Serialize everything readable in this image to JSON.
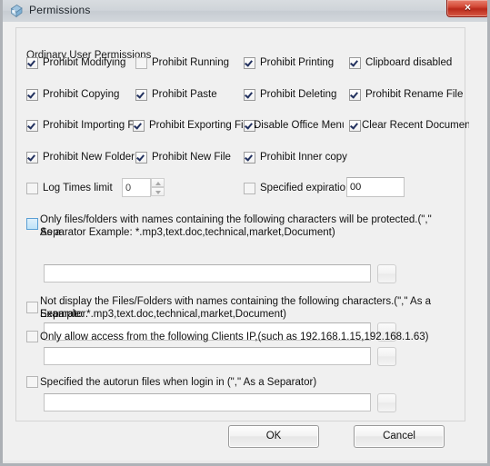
{
  "window": {
    "title": "Permissions",
    "icon": "shield-app-icon",
    "close_label": "×"
  },
  "group": {
    "legend": "Ordinary User Permissions"
  },
  "permission_checkboxes": [
    {
      "label": "Prohibit Modifying",
      "checked": true,
      "state": "normal"
    },
    {
      "label": "Prohibit Running",
      "checked": false,
      "state": "dim"
    },
    {
      "label": "Prohibit Printing",
      "checked": true,
      "state": "normal"
    },
    {
      "label": "Clipboard disabled",
      "checked": true,
      "state": "normal"
    },
    {
      "label": "Prohibit Copying",
      "checked": true,
      "state": "normal"
    },
    {
      "label": "Prohibit Paste",
      "checked": true,
      "state": "normal"
    },
    {
      "label": "Prohibit Deleting",
      "checked": true,
      "state": "normal"
    },
    {
      "label": "Prohibit Rename File",
      "checked": true,
      "state": "normal"
    },
    {
      "label": "Prohibit Importing File",
      "checked": true,
      "state": "normal"
    },
    {
      "label": "Prohibit Exporting Files",
      "checked": true,
      "state": "normal"
    },
    {
      "label": "Disable Office Menu",
      "checked": true,
      "state": "normal"
    },
    {
      "label": "Clear Recent Document",
      "checked": true,
      "state": "normal"
    },
    {
      "label": "Prohibit New Folder",
      "checked": true,
      "state": "normal"
    },
    {
      "label": "Prohibit New File",
      "checked": true,
      "state": "normal"
    },
    {
      "label": "Prohibit Inner copy",
      "checked": true,
      "state": "normal"
    }
  ],
  "log_times": {
    "label": "Log Times limit",
    "checked": false,
    "value": "0"
  },
  "expiration": {
    "label": "Specified expiration d",
    "checked": false,
    "value": "00"
  },
  "sections": [
    {
      "name": "protected-names",
      "checked": false,
      "state": "hover",
      "line1": "Only files/folders with names containing the following characters will be protected.(\",\" As a",
      "line2": "Separator Example: *.mp3,text.doc,technical,market,Document)",
      "input_value": "",
      "browse_label": ""
    },
    {
      "name": "hidden-names",
      "checked": false,
      "state": "dim",
      "line1": "Not display the Files/Folders with names containing the following characters.(\",\" As a Separator.",
      "line2": "Example: *.mp3,text.doc,technical,market,Document)",
      "input_value": "",
      "browse_label": ""
    },
    {
      "name": "client-ip",
      "checked": false,
      "state": "dim",
      "line1": "Only allow access from the following Clients IP,(such as 192.168.1.15,192.168.1.63)",
      "line2": "",
      "input_value": "",
      "browse_label": ""
    },
    {
      "name": "autorun-files",
      "checked": false,
      "state": "dim",
      "line1": "Specified the autorun files when login in (\",\" As a Separator)",
      "line2": "",
      "input_value": "",
      "browse_label": ""
    }
  ],
  "buttons": {
    "ok": "OK",
    "cancel": "Cancel"
  }
}
